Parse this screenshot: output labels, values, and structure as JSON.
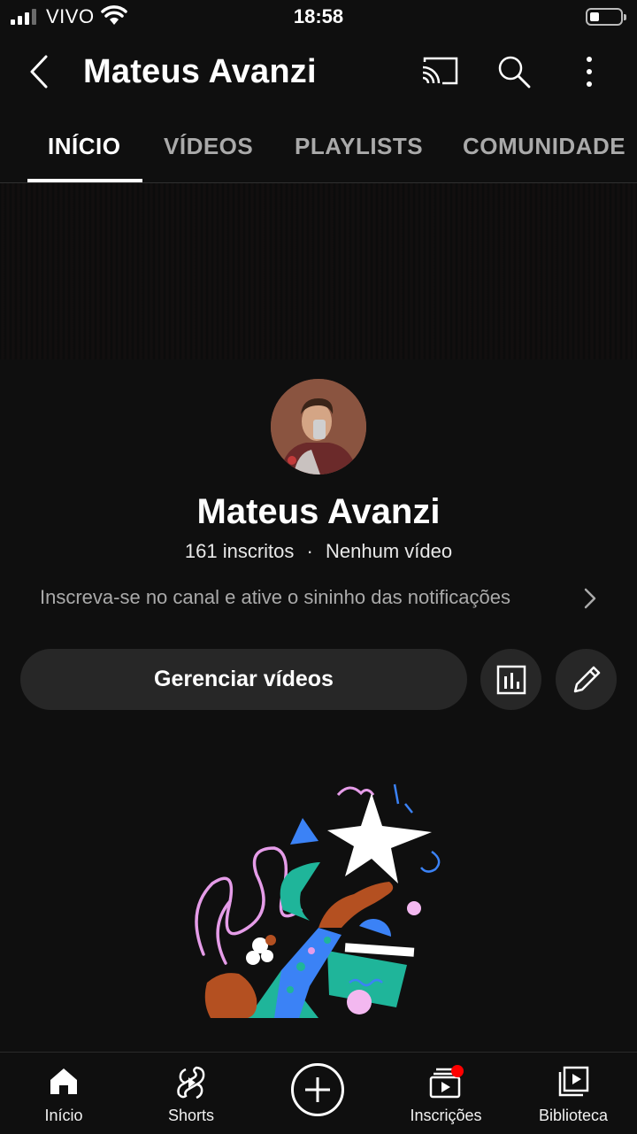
{
  "status_bar": {
    "carrier": "VIVO",
    "time": "18:58"
  },
  "header": {
    "title": "Mateus Avanzi",
    "icons": [
      "back-arrow-icon",
      "cast-icon",
      "search-icon",
      "more-vert-icon"
    ]
  },
  "tabs": [
    {
      "label": "INÍCIO",
      "active": true
    },
    {
      "label": "VÍDEOS",
      "active": false
    },
    {
      "label": "PLAYLISTS",
      "active": false
    },
    {
      "label": "COMUNIDADE",
      "active": false
    }
  ],
  "channel": {
    "name": "Mateus Avanzi",
    "subscribers": "161 inscritos",
    "separator": "·",
    "videos": "Nenhum vídeo",
    "description": "Inscreva-se no canal e ative o sininho das notificações"
  },
  "actions": {
    "manage_label": "Gerenciar vídeos",
    "icons": [
      "analytics-icon",
      "edit-pencil-icon"
    ]
  },
  "bottom_nav": [
    {
      "label": "Início",
      "icon": "home-icon"
    },
    {
      "label": "Shorts",
      "icon": "shorts-icon"
    },
    {
      "label": "",
      "icon": "create-plus-icon"
    },
    {
      "label": "Inscrições",
      "icon": "subscriptions-icon"
    },
    {
      "label": "Biblioteca",
      "icon": "library-icon"
    }
  ],
  "colors": {
    "background": "#0f0f0f",
    "surface": "#272727",
    "text_secondary": "#aaaaaa",
    "notification_dot": "#ff0000"
  }
}
